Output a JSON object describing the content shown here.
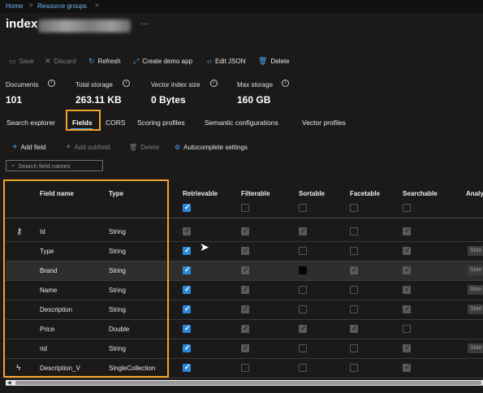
{
  "breadcrumb": {
    "home": "Home",
    "sep1": ">",
    "resource_groups": "Resource groups",
    "sep2": ">"
  },
  "page": {
    "title_prefix": "index",
    "more": "···"
  },
  "toolbar": {
    "save": "Save",
    "discard": "Discard",
    "refresh": "Refresh",
    "create_demo_app": "Create demo app",
    "edit_json": "Edit JSON",
    "delete": "Delete"
  },
  "stats": [
    {
      "label": "Documents",
      "value": "101"
    },
    {
      "label": "Total storage",
      "value": "263.11 KB"
    },
    {
      "label": "Vector index size",
      "value": "0 Bytes"
    },
    {
      "label": "Max storage",
      "value": "160 GB"
    }
  ],
  "tabs": [
    "Search explorer",
    "Fields",
    "CORS",
    "Scoring profiles",
    "Semantic configurations",
    "Vector profiles"
  ],
  "active_tab": "Fields",
  "commands": {
    "add_field": "Add field",
    "add_subfield": "Add subfield",
    "delete": "Delete",
    "autocomplete": "Autocomplete settings"
  },
  "search": {
    "placeholder": "Search field names"
  },
  "columns": [
    "Field name",
    "Type",
    "Retrievable",
    "Filterable",
    "Sortable",
    "Facetable",
    "Searchable",
    "Analy"
  ],
  "fields": [
    {
      "name": "Id",
      "type": "String",
      "key": true,
      "vector": false,
      "checks": [
        "dim",
        "dim",
        "dim",
        "off",
        "dim"
      ],
      "analyzer": ""
    },
    {
      "name": "Type",
      "type": "String",
      "key": false,
      "vector": false,
      "checks": [
        "on",
        "dim",
        "off",
        "off",
        "dim"
      ],
      "analyzer": "Stan"
    },
    {
      "name": "Brand",
      "type": "String",
      "key": false,
      "vector": false,
      "checks": [
        "on",
        "dim",
        "black",
        "dim",
        "dim"
      ],
      "analyzer": "Stan"
    },
    {
      "name": "Name",
      "type": "String",
      "key": false,
      "vector": false,
      "checks": [
        "on",
        "dim",
        "off",
        "off",
        "dim"
      ],
      "analyzer": "Stan"
    },
    {
      "name": "Description",
      "type": "String",
      "key": false,
      "vector": false,
      "checks": [
        "on",
        "dim",
        "off",
        "off",
        "dim"
      ],
      "analyzer": "Stan"
    },
    {
      "name": "Price",
      "type": "Double",
      "key": false,
      "vector": false,
      "checks": [
        "on",
        "dim",
        "dim",
        "dim",
        "off"
      ],
      "analyzer": ""
    },
    {
      "name": "rid",
      "type": "String",
      "key": false,
      "vector": false,
      "checks": [
        "on",
        "dim",
        "off",
        "off",
        "dim"
      ],
      "analyzer": "Stan"
    },
    {
      "name": "Description_V",
      "type": "SingleCollection",
      "key": false,
      "vector": true,
      "checks": [
        "on",
        "off",
        "off",
        "off",
        "dim"
      ],
      "analyzer": ""
    }
  ],
  "colors": {
    "accent": "#4aa3f0",
    "highlight_box": "#f2a32b",
    "checkbox_on": "#2b88d8"
  }
}
